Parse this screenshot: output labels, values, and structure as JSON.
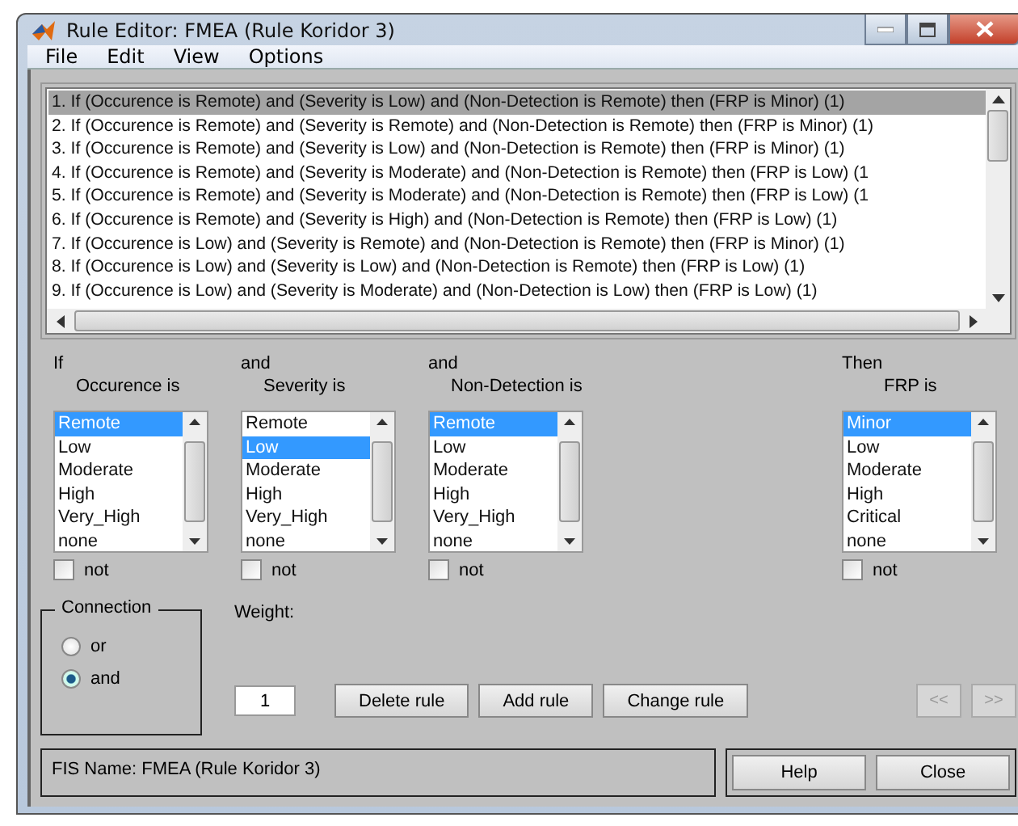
{
  "window": {
    "title": "Rule Editor: FMEA (Rule Koridor 3)"
  },
  "menu": [
    "File",
    "Edit",
    "View",
    "Options"
  ],
  "rules": [
    {
      "text": "1. If (Occurence is Remote) and (Severity is Low) and (Non-Detection is Remote) then (FRP is Minor) (1)",
      "selected": true
    },
    {
      "text": "2. If (Occurence is Remote) and (Severity is Remote) and (Non-Detection is Remote) then (FRP is Minor) (1)",
      "selected": false
    },
    {
      "text": "3. If (Occurence is Remote) and (Severity is Low) and (Non-Detection is Remote) then (FRP is Minor) (1)",
      "selected": false
    },
    {
      "text": "4. If (Occurence is Remote) and (Severity is Moderate) and (Non-Detection is Remote) then (FRP is Low) (1",
      "selected": false
    },
    {
      "text": "5. If (Occurence is Remote) and (Severity is Moderate) and (Non-Detection is Remote) then (FRP is Low) (1",
      "selected": false
    },
    {
      "text": "6. If (Occurence is Remote) and (Severity is High) and (Non-Detection is Remote) then (FRP is Low) (1)",
      "selected": false
    },
    {
      "text": "7. If (Occurence is Low) and (Severity is Remote) and (Non-Detection is Remote) then (FRP is Minor) (1)",
      "selected": false
    },
    {
      "text": "8. If (Occurence is Low) and (Severity is Low) and (Non-Detection is Remote) then (FRP is Low) (1)",
      "selected": false
    },
    {
      "text": "9. If (Occurence is Low) and (Severity is Moderate) and (Non-Detection is Low) then (FRP is Low) (1)",
      "selected": false
    }
  ],
  "variables": [
    {
      "kind": "antecedent",
      "conjunction": "If",
      "label": "Occurence is",
      "not_label": "not",
      "not": false,
      "options": [
        {
          "label": "Remote",
          "selected": true
        },
        {
          "label": "Low",
          "selected": false
        },
        {
          "label": "Moderate",
          "selected": false
        },
        {
          "label": "High",
          "selected": false
        },
        {
          "label": "Very_High",
          "selected": false
        },
        {
          "label": "none",
          "selected": false
        }
      ]
    },
    {
      "kind": "antecedent",
      "conjunction": "and",
      "label": "Severity is",
      "not_label": "not",
      "not": false,
      "options": [
        {
          "label": "Remote",
          "selected": false
        },
        {
          "label": "Low",
          "selected": true
        },
        {
          "label": "Moderate",
          "selected": false
        },
        {
          "label": "High",
          "selected": false
        },
        {
          "label": "Very_High",
          "selected": false
        },
        {
          "label": "none",
          "selected": false
        }
      ]
    },
    {
      "kind": "antecedent",
      "conjunction": "and",
      "label": "Non-Detection is",
      "not_label": "not",
      "not": false,
      "options": [
        {
          "label": "Remote",
          "selected": true
        },
        {
          "label": "Low",
          "selected": false
        },
        {
          "label": "Moderate",
          "selected": false
        },
        {
          "label": "High",
          "selected": false
        },
        {
          "label": "Very_High",
          "selected": false
        },
        {
          "label": "none",
          "selected": false
        }
      ]
    },
    {
      "kind": "consequent",
      "conjunction": "Then",
      "label": "FRP is",
      "not_label": "not",
      "not": false,
      "options": [
        {
          "label": "Minor",
          "selected": true
        },
        {
          "label": "Low",
          "selected": false
        },
        {
          "label": "Moderate",
          "selected": false
        },
        {
          "label": "High",
          "selected": false
        },
        {
          "label": "Critical",
          "selected": false
        },
        {
          "label": "none",
          "selected": false
        }
      ]
    }
  ],
  "connection": {
    "label": "Connection",
    "options": [
      {
        "label": "or",
        "selected": false
      },
      {
        "label": "and",
        "selected": true
      }
    ]
  },
  "weight": {
    "label": "Weight:",
    "value": "1"
  },
  "buttons": [
    {
      "label": "Delete rule",
      "disabled": false
    },
    {
      "label": "Add rule",
      "disabled": false
    },
    {
      "label": "Change rule",
      "disabled": false
    }
  ],
  "nav_buttons": [
    {
      "label": "<<",
      "disabled": true
    },
    {
      "label": ">>",
      "disabled": true
    }
  ],
  "status": "FIS Name: FMEA (Rule Koridor 3)",
  "footer_buttons": [
    "Help",
    "Close"
  ]
}
